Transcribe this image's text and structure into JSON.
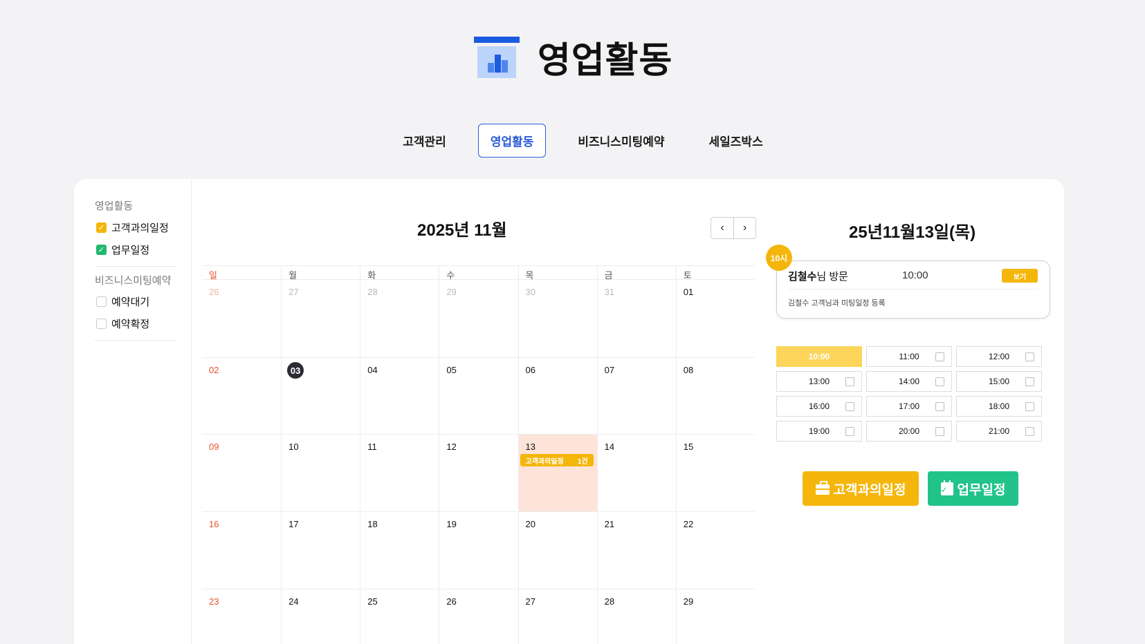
{
  "brand": {
    "title": "영업활동",
    "colors": {
      "primary": "#1a5be0",
      "light": "#bcd3fb"
    }
  },
  "nav": {
    "tabs": [
      {
        "label": "고객관리",
        "active": false
      },
      {
        "label": "영업활동",
        "active": true
      },
      {
        "label": "비즈니스미팅예약",
        "active": false
      },
      {
        "label": "세일즈박스",
        "active": false
      }
    ]
  },
  "sidebar": {
    "section1": {
      "heading": "영업활동",
      "items": [
        {
          "label": "고객과의일정",
          "checked": true,
          "color": "#f5b60c"
        },
        {
          "label": "업무일정",
          "checked": true,
          "color": "#22b86f"
        }
      ]
    },
    "section2": {
      "heading": "비즈니스미팅예약",
      "items": [
        {
          "label": "예약대기",
          "checked": false
        },
        {
          "label": "예약확정",
          "checked": false
        }
      ]
    }
  },
  "calendar": {
    "title": "2025년 11월",
    "prev_icon": "chevron-left-icon",
    "next_icon": "chevron-right-icon",
    "weekdays": [
      "일",
      "월",
      "화",
      "수",
      "목",
      "금",
      "토"
    ],
    "weeks": [
      [
        "26",
        "27",
        "28",
        "29",
        "30",
        "31",
        "01"
      ],
      [
        "02",
        "03",
        "04",
        "05",
        "06",
        "07",
        "08"
      ],
      [
        "09",
        "10",
        "11",
        "12",
        "13",
        "14",
        "15"
      ],
      [
        "16",
        "17",
        "18",
        "19",
        "20",
        "21",
        "22"
      ],
      [
        "23",
        "24",
        "25",
        "26",
        "27",
        "28",
        "29"
      ]
    ],
    "today": "03",
    "selected": "13",
    "event": {
      "label": "고객과의일정",
      "count": "1건"
    }
  },
  "detail": {
    "date_title": "25년11월13일(목)",
    "hour_badge": "10시",
    "appointment": {
      "name": "김철수",
      "name_suffix": "님 방문",
      "time": "10:00",
      "view_label": "보기",
      "description": "김철수 고객님과 미팅일정 등록"
    },
    "slots": [
      {
        "time": "10:00",
        "active": true
      },
      {
        "time": "11:00"
      },
      {
        "time": "12:00"
      },
      {
        "time": "13:00"
      },
      {
        "time": "14:00"
      },
      {
        "time": "15:00"
      },
      {
        "time": "16:00"
      },
      {
        "time": "17:00"
      },
      {
        "time": "18:00"
      },
      {
        "time": "19:00"
      },
      {
        "time": "20:00"
      },
      {
        "time": "21:00"
      }
    ],
    "actions": {
      "client_label": "고객과의일정",
      "client_icon": "briefcase-icon",
      "work_label": "업무일정",
      "work_icon": "calendar-check-icon"
    }
  }
}
